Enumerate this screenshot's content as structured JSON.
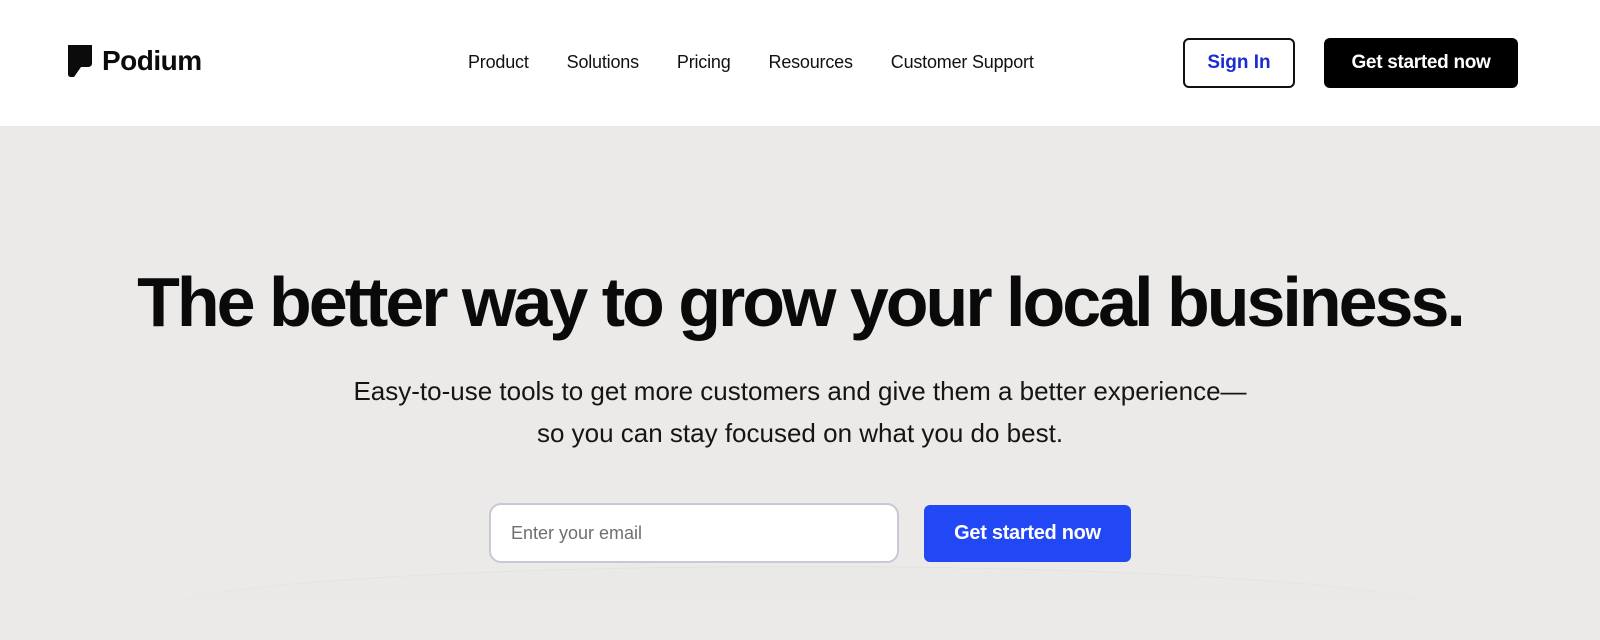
{
  "brand": {
    "name": "Podium"
  },
  "nav": {
    "items": [
      {
        "label": "Product"
      },
      {
        "label": "Solutions"
      },
      {
        "label": "Pricing"
      },
      {
        "label": "Resources"
      },
      {
        "label": "Customer Support"
      }
    ]
  },
  "header": {
    "signin_label": "Sign In",
    "cta_label": "Get started now"
  },
  "hero": {
    "headline": "The better way to grow your local business.",
    "subtitle_line1": "Easy-to-use tools to get more customers and give them a better experience—",
    "subtitle_line2": "so you can stay focused on what you do best.",
    "email_placeholder": "Enter your email",
    "email_value": "",
    "cta_label": "Get started now"
  },
  "colors": {
    "hero_background": "#eceae8",
    "primary_cta": "#2247f5",
    "signin_text": "#1a2dd1",
    "header_cta": "#000000"
  }
}
